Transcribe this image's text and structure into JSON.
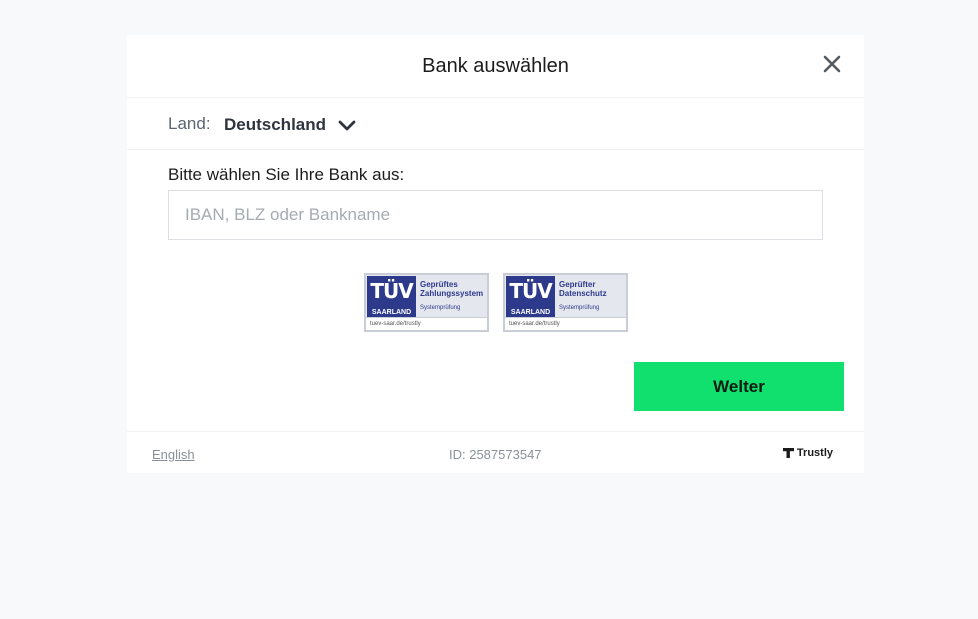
{
  "modal": {
    "title": "Bank auswählen",
    "close_icon": "close-icon"
  },
  "country": {
    "label": "Land:",
    "value": "Deutschland",
    "dropdown_icon": "chevron-down-icon"
  },
  "bank": {
    "label": "Bitte wählen Sie Ihre Bank aus:",
    "placeholder": "IBAN, BLZ oder Bankname",
    "value": ""
  },
  "badges": [
    {
      "logo_text": "TÜV",
      "logo_sub": "SAARLAND",
      "title": "Geprüftes Zahlungssystem",
      "note": "Systemprüfung",
      "url": "tuev-saar.de/trustly"
    },
    {
      "logo_text": "TÜV",
      "logo_sub": "SAARLAND",
      "title": "Geprüfter Datenschutz",
      "note": "Systemprüfung",
      "url": "tuev-saar.de/trustly"
    }
  ],
  "actions": {
    "next_label": "Welter"
  },
  "footer": {
    "language_link": "English",
    "session_id": "ID: 2587573547",
    "brand": "Trustly"
  },
  "colors": {
    "primary_button": "#12e06e",
    "badge_blue": "#2d3a8c",
    "background": "#f8f9fb"
  }
}
